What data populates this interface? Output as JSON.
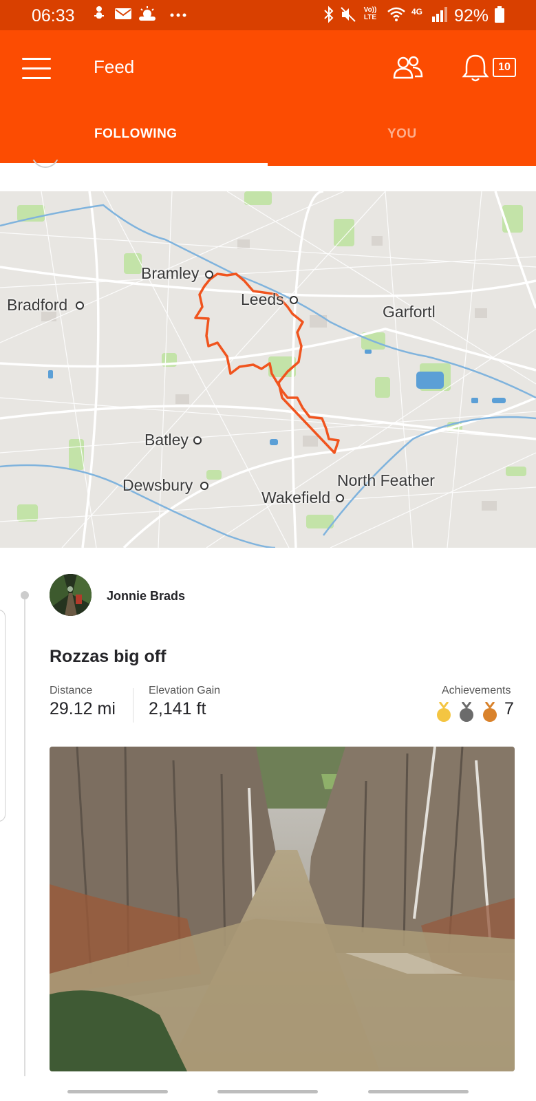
{
  "status_bar": {
    "time": "06:33",
    "battery": "92%",
    "left_icons": [
      "mic-person-icon",
      "mail-icon",
      "weather-icon",
      "more-icon"
    ],
    "right_icons": [
      "bluetooth-icon",
      "mute-icon",
      "volte-icon",
      "wifi-icon",
      "4g-icon",
      "signal-icon",
      "battery-icon"
    ],
    "volte_text": "Vo)) LTE",
    "network_text": "4G"
  },
  "app_bar": {
    "title": "Feed",
    "notification_count": "10",
    "color": "#fc4c02"
  },
  "tabs": [
    {
      "label": "FOLLOWING",
      "active": true
    },
    {
      "label": "YOU",
      "active": false
    }
  ],
  "map": {
    "places": [
      "Bramley",
      "Leeds",
      "Bradford",
      "Garfortl",
      "Batley",
      "Dewsbury",
      "North Feather",
      "Wakefield"
    ],
    "route_color": "#f0541e"
  },
  "activity": {
    "athlete_name": "Jonnie Brads",
    "title": "Rozzas big off",
    "stats": [
      {
        "label": "Distance",
        "value": "29.12 mi"
      },
      {
        "label": "Elevation Gain",
        "value": "2,141 ft"
      }
    ],
    "achievements": {
      "label": "Achievements",
      "count": "7",
      "medals": [
        "gold-medal-icon",
        "silver-medal-icon",
        "bronze-medal-icon"
      ]
    }
  }
}
